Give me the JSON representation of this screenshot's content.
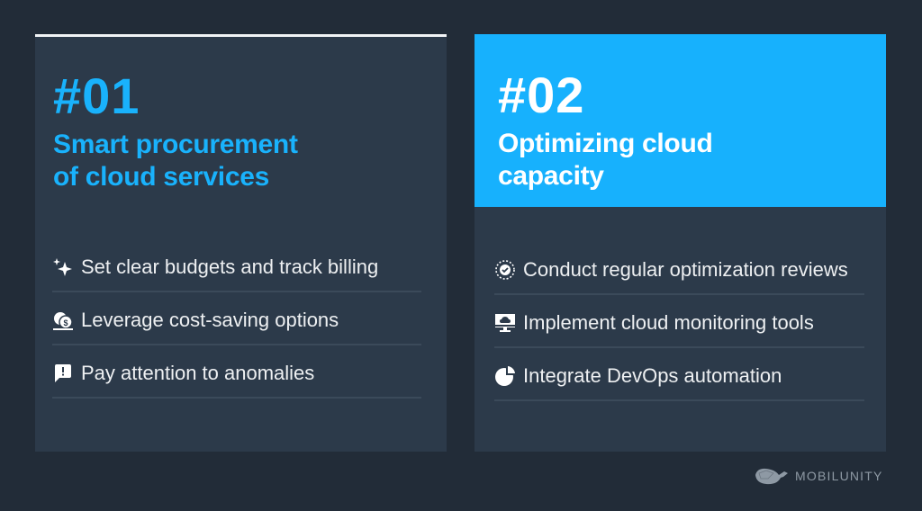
{
  "cards": [
    {
      "number": "#01",
      "title_line1": "Smart procurement",
      "title_line2": "of cloud services",
      "items": [
        {
          "icon": "sparkles-icon",
          "label": "Set clear budgets and track billing"
        },
        {
          "icon": "coins-dollar-icon",
          "label": "Leverage cost-saving options"
        },
        {
          "icon": "alert-message-icon",
          "label": "Pay attention to anomalies"
        }
      ]
    },
    {
      "number": "#02",
      "title_line1": "Optimizing cloud",
      "title_line2": "capacity",
      "items": [
        {
          "icon": "review-cycle-check-icon",
          "label": "Conduct regular optimization reviews"
        },
        {
          "icon": "cloud-monitor-icon",
          "label": "Implement cloud monitoring tools"
        },
        {
          "icon": "pie-chart-icon",
          "label": "Integrate DevOps automation"
        }
      ]
    }
  ],
  "brand": {
    "name": "MOBILUNITY",
    "logo_icon": "whale-logo-icon"
  },
  "colors": {
    "accent": "#17b1fd",
    "background": "#222c38",
    "card": "#2c3a4a"
  }
}
